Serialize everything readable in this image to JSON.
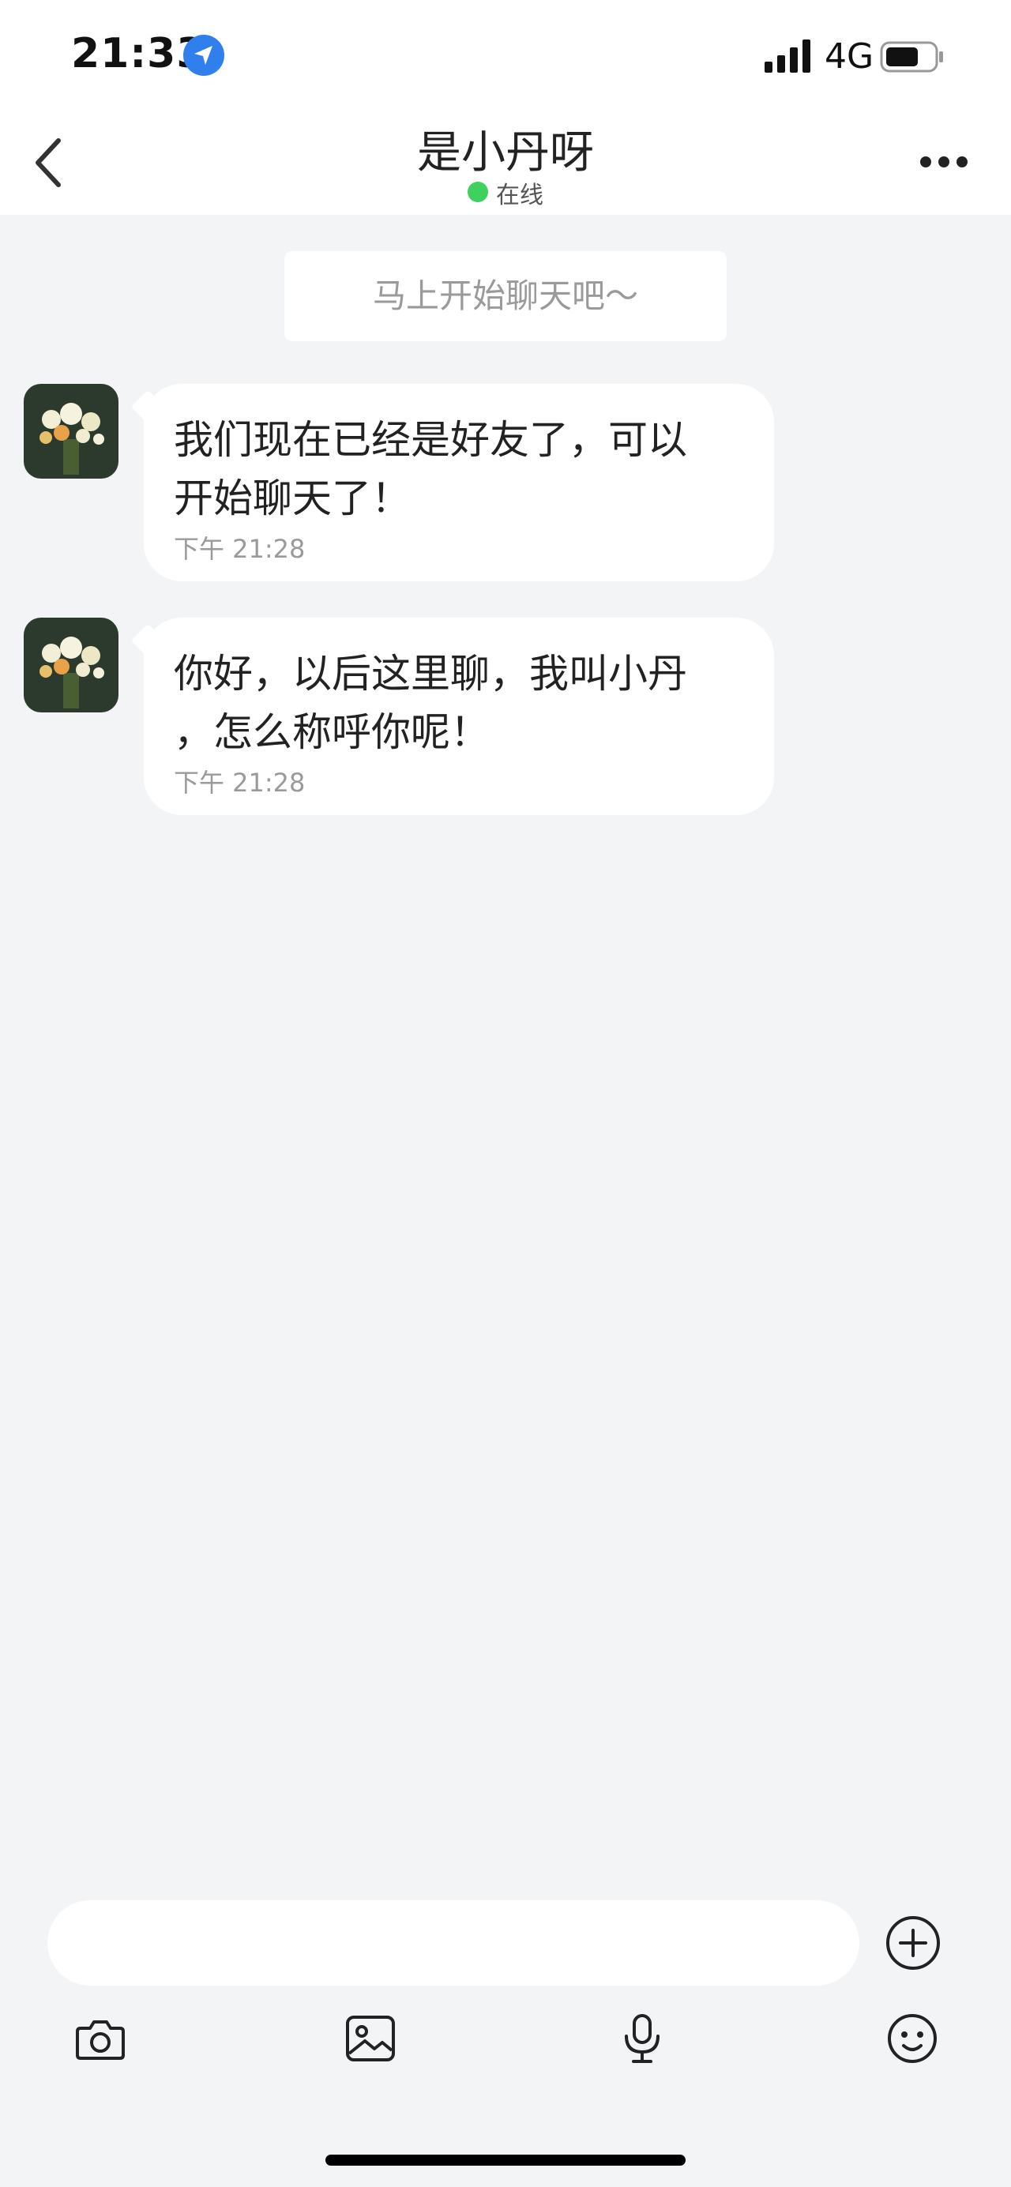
{
  "status_bar": {
    "time": "21:33",
    "network": "4G"
  },
  "header": {
    "title": "是小丹呀",
    "status": "在线"
  },
  "system_tip": "马上开始聊天吧～",
  "messages": [
    {
      "text": "我们现在已经是好友了，可以\n开始聊天了！",
      "time": "下午 21:28"
    },
    {
      "text": "你好，以后这里聊，我叫小丹\n，怎么称呼你呢！",
      "time": "下午 21:28"
    }
  ],
  "input": {
    "placeholder": "",
    "value": ""
  },
  "toolbar": [
    "camera-icon",
    "image-icon",
    "microphone-icon",
    "emoji-icon"
  ],
  "colors": {
    "online": "#3ed15e",
    "location_badge": "#2f80ed",
    "background": "#f3f4f6"
  }
}
